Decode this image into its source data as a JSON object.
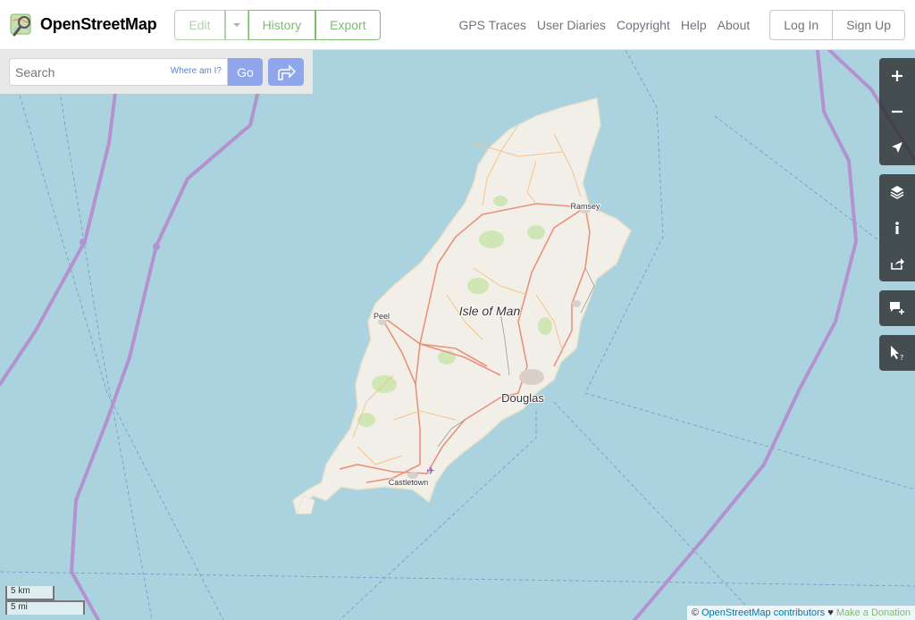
{
  "brand": {
    "title": "OpenStreetMap"
  },
  "edit_group": {
    "edit": "Edit",
    "history": "History",
    "export": "Export"
  },
  "nav": [
    "GPS Traces",
    "User Diaries",
    "Copyright",
    "Help",
    "About"
  ],
  "auth": {
    "login": "Log In",
    "signup": "Sign Up"
  },
  "search": {
    "placeholder": "Search",
    "where_am_i": "Where am I?",
    "go": "Go"
  },
  "map": {
    "labels": {
      "island": "Isle of Man",
      "ramsey": "Ramsey",
      "peel": "Peel",
      "douglas": "Douglas",
      "castletown": "Castletown"
    },
    "colors": {
      "sea": "#aad3df",
      "land": "#f2efe9",
      "boundary": "#b392d0",
      "road": "#e8927c"
    }
  },
  "controls": [
    "zoom-in",
    "zoom-out",
    "locate",
    "layers",
    "info",
    "share",
    "note",
    "query"
  ],
  "scale": {
    "km": "5 km",
    "mi": "5 mi"
  },
  "attribution": {
    "copy": "©",
    "osm": "OpenStreetMap contributors",
    "heart": "♥",
    "donate": "Make a Donation"
  }
}
